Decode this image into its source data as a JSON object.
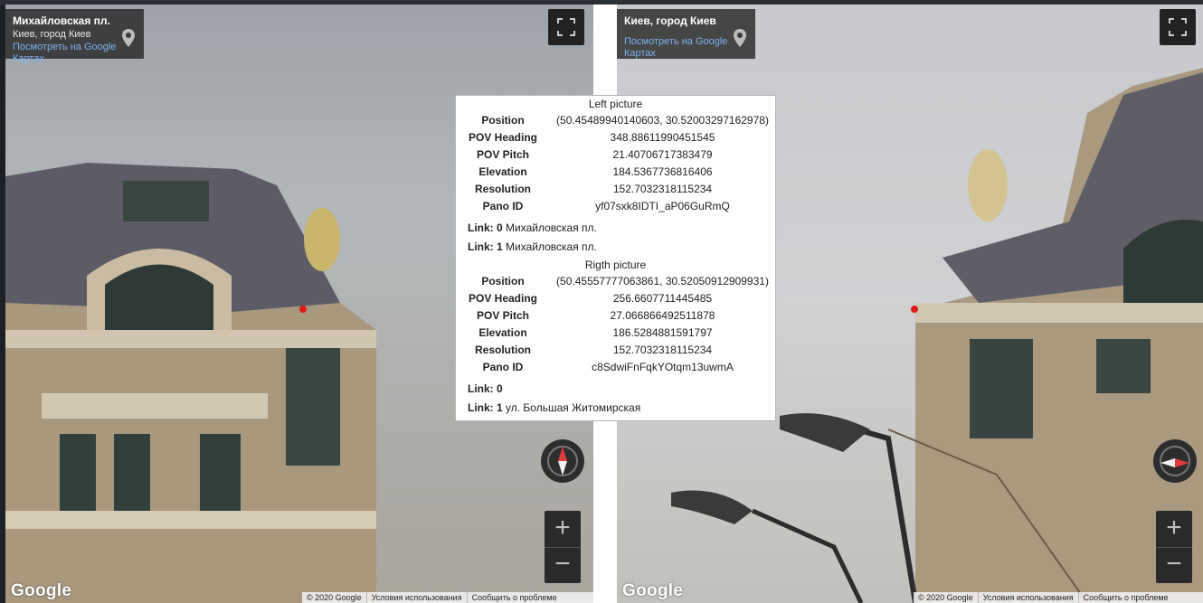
{
  "left_pano": {
    "place_title": "Михайловская пл.",
    "place_subtitle": "Киев, город Киев",
    "maps_link_line1": "Посмотреть на Google",
    "maps_link_line2": "Картах",
    "brand": "Google",
    "footer": [
      "© 2020 Google",
      "Условия использования",
      "Сообщить о проблеме"
    ]
  },
  "right_pano": {
    "place_title": "Киев, город Киев",
    "maps_link_line1": "Посмотреть на Google",
    "maps_link_line2": "Картах",
    "brand": "Google",
    "footer": [
      "© 2020 Google",
      "Условия использования",
      "Сообщить о проблеме"
    ]
  },
  "controls": {
    "zoom_in": "+",
    "zoom_out": "−",
    "icons": [
      "fullscreen-icon",
      "map-pin-icon",
      "compass-icon"
    ]
  },
  "colors": {
    "marker": "#e01b1b",
    "link": "#7cb1f0"
  },
  "info": {
    "left": {
      "heading": "Left picture",
      "rows": [
        {
          "label": "Position",
          "value": "(50.45489940140603, 30.52003297162978)"
        },
        {
          "label": "POV Heading",
          "value": "348.88611990451545"
        },
        {
          "label": "POV Pitch",
          "value": "21.40706717383479"
        },
        {
          "label": "Elevation",
          "value": "184.5367736816406"
        },
        {
          "label": "Resolution",
          "value": "152.7032318115234"
        },
        {
          "label": "Pano ID",
          "value": "yf07sxk8IDTI_aP06GuRmQ"
        }
      ],
      "links": [
        {
          "label": "Link: 0",
          "value": "Михайловская пл."
        },
        {
          "label": "Link: 1",
          "value": "Михайловская пл."
        }
      ]
    },
    "right": {
      "heading": "Rigth picture",
      "rows": [
        {
          "label": "Position",
          "value": "(50.45557777063861, 30.52050912909931)"
        },
        {
          "label": "POV Heading",
          "value": "256.6607711445485"
        },
        {
          "label": "POV Pitch",
          "value": "27.066866492511878"
        },
        {
          "label": "Elevation",
          "value": "186.5284881591797"
        },
        {
          "label": "Resolution",
          "value": "152.7032318115234"
        },
        {
          "label": "Pano ID",
          "value": "c8SdwiFnFqkYOtqm13uwmA"
        }
      ],
      "links": [
        {
          "label": "Link: 0",
          "value": ""
        },
        {
          "label": "Link: 1",
          "value": "ул. Большая Житомирская"
        }
      ]
    }
  }
}
